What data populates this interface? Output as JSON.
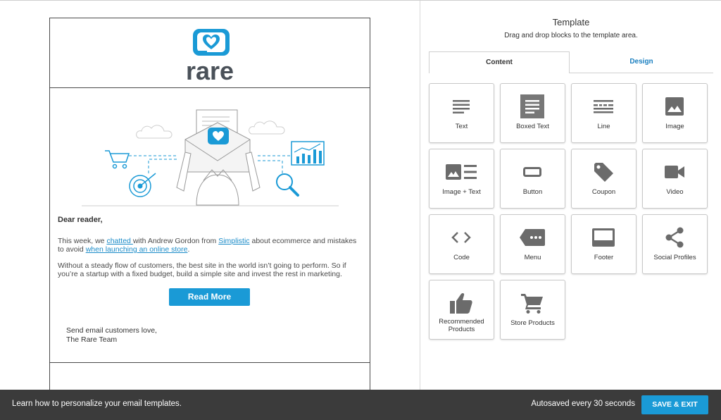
{
  "email": {
    "logo_text": "rare",
    "greeting": "Dear reader,",
    "para1": {
      "t1": "This week, we ",
      "link1": "chatted ",
      "t2": "with Andrew Gordon from ",
      "link2": "Simplistic",
      "t3": " about ecommerce and mistakes to avoid ",
      "link3": "when launching an online store",
      "t4": "."
    },
    "para2": "Without a steady flow of customers, the best site in the world isn’t going to perform. So if you’re a startup with a fixed budget, build a simple site and invest the rest in marketing.",
    "read_more": "Read More",
    "signoff_line1": "Send email customers love,",
    "signoff_line2": "The Rare Team"
  },
  "panel": {
    "title": "Template",
    "subtitle": "Drag and drop blocks to the template area.",
    "tabs": [
      {
        "label": "Content",
        "active": true
      },
      {
        "label": "Design",
        "active": false
      }
    ],
    "blocks": [
      {
        "label": "Text",
        "icon": "text-icon"
      },
      {
        "label": "Boxed Text",
        "icon": "boxed-text-icon"
      },
      {
        "label": "Line",
        "icon": "line-icon"
      },
      {
        "label": "Image",
        "icon": "image-icon"
      },
      {
        "label": "Image + Text",
        "icon": "image-text-icon"
      },
      {
        "label": "Button",
        "icon": "button-icon"
      },
      {
        "label": "Coupon",
        "icon": "coupon-icon"
      },
      {
        "label": "Video",
        "icon": "video-icon"
      },
      {
        "label": "Code",
        "icon": "code-icon"
      },
      {
        "label": "Menu",
        "icon": "menu-icon"
      },
      {
        "label": "Footer",
        "icon": "footer-icon"
      },
      {
        "label": "Social Profiles",
        "icon": "share-icon"
      },
      {
        "label": "Recommended Products",
        "label_line1": "Recommended",
        "label_line2": "Products",
        "icon": "thumbs-up-icon"
      },
      {
        "label": "Store Products",
        "icon": "cart-icon"
      }
    ]
  },
  "footer_bar": {
    "hint": "Learn how to personalize your email templates.",
    "autosave": "Autosaved every 30 seconds",
    "save_exit": "SAVE & EXIT"
  },
  "colors": {
    "accent": "#1a9ad6",
    "link": "#1a8bc8",
    "icon_gray": "#6b6b6b",
    "bottom_bar": "#3b3b3b"
  }
}
